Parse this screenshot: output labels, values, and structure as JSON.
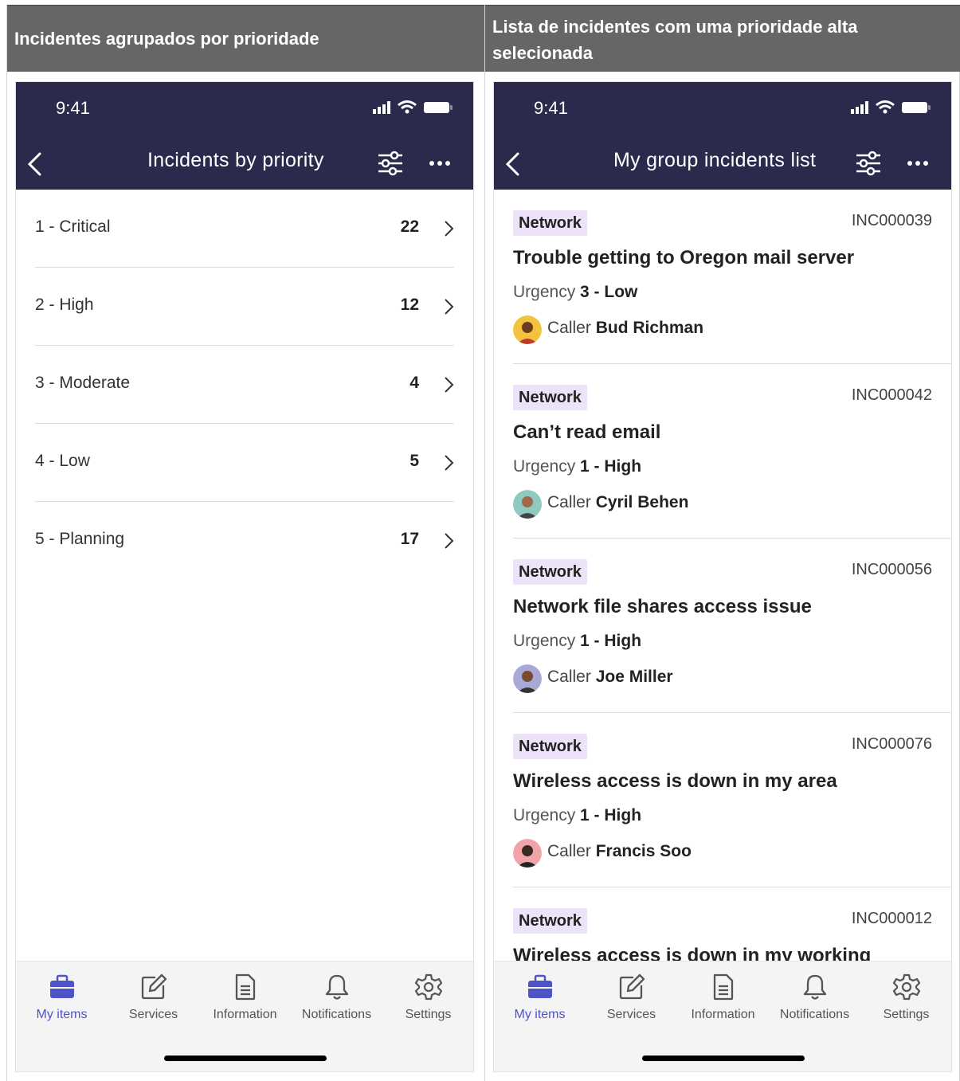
{
  "headers": {
    "left": "Incidentes agrupados por prioridade",
    "right": "Lista de incidentes com uma prioridade alta selecionada"
  },
  "left_phone": {
    "status_time": "9:41",
    "title": "Incidents by priority",
    "priorities": [
      {
        "label": "1 - Critical",
        "count": "22"
      },
      {
        "label": "2 - High",
        "count": "12"
      },
      {
        "label": "3 - Moderate",
        "count": "4"
      },
      {
        "label": "4 - Low",
        "count": "5"
      },
      {
        "label": "5 - Planning",
        "count": "17"
      }
    ]
  },
  "right_phone": {
    "status_time": "9:41",
    "title": "My group incidents list",
    "urgency_label": "Urgency",
    "caller_label": "Caller",
    "incidents": [
      {
        "category": "Network",
        "number": "INC000039",
        "title": "Trouble getting to Oregon mail server",
        "urgency": "3 - Low",
        "caller": "Bud Richman"
      },
      {
        "category": "Network",
        "number": "INC000042",
        "title": "Can’t read email",
        "urgency": "1 - High",
        "caller": "Cyril Behen"
      },
      {
        "category": "Network",
        "number": "INC000056",
        "title": "Network file shares access issue",
        "urgency": "1 - High",
        "caller": "Joe Miller"
      },
      {
        "category": "Network",
        "number": "INC000076",
        "title": "Wireless access is down in my area",
        "urgency": "1 - High",
        "caller": "Francis Soo"
      },
      {
        "category": "Network",
        "number": "INC000012",
        "title": "Wireless access is down in my working",
        "urgency": "",
        "caller": ""
      }
    ]
  },
  "tabs": [
    "My items",
    "Services",
    "Information",
    "Notifications",
    "Settings"
  ],
  "colors": {
    "appbar": "#2b2a4c",
    "active_tab": "#4e54c8",
    "badge_bg": "#ece3f8",
    "header_bg": "#666666"
  }
}
